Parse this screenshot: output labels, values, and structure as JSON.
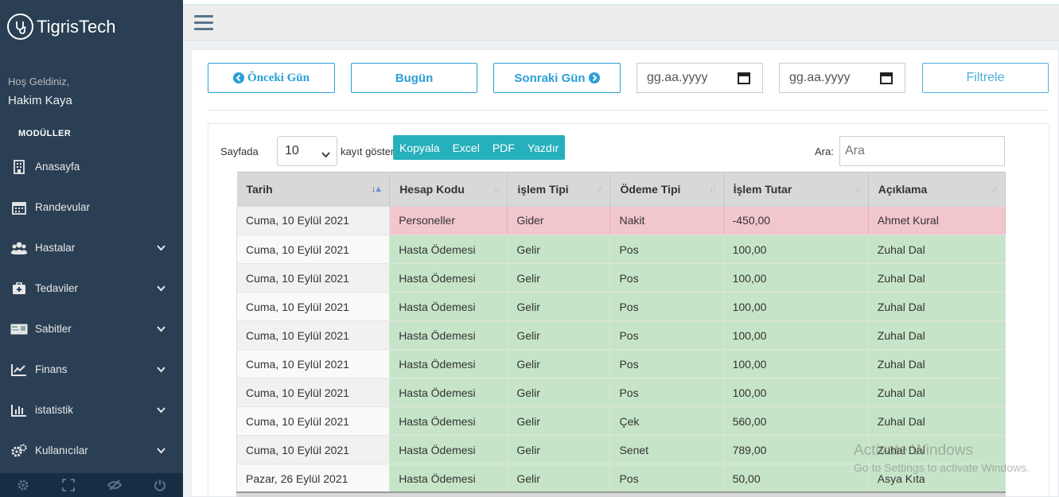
{
  "brand": {
    "name": "TigrisTech",
    "logo_icon": "stethoscope-icon"
  },
  "sidebar": {
    "welcome": "Hoş Geldiniz,",
    "username": "Hakim Kaya",
    "section_title": "MODÜLLER",
    "items": [
      {
        "label": "Anasayfa",
        "icon": "building-icon",
        "has_submenu": false
      },
      {
        "label": "Randevular",
        "icon": "calendar-icon",
        "has_submenu": false
      },
      {
        "label": "Hastalar",
        "icon": "users-icon",
        "has_submenu": true
      },
      {
        "label": "Tedaviler",
        "icon": "medkit-icon",
        "has_submenu": true
      },
      {
        "label": "Sabitler",
        "icon": "id-card-icon",
        "has_submenu": true
      },
      {
        "label": "Finans",
        "icon": "line-chart-icon",
        "has_submenu": true
      },
      {
        "label": "istatistik",
        "icon": "bar-chart-icon",
        "has_submenu": true
      },
      {
        "label": "Kullanıcılar",
        "icon": "cogs-icon",
        "has_submenu": true
      }
    ],
    "footer_icons": [
      "settings-icon",
      "fullscreen-icon",
      "eye-slash-icon",
      "power-icon"
    ]
  },
  "toolbar": {
    "prev_day": "Önceki Gün",
    "today": "Bugün",
    "next_day": "Sonraki Gün",
    "date_placeholder_start": "gg.aa.yyyy",
    "date_placeholder_end": "gg.aa.yyyy",
    "filter": "Filtrele"
  },
  "table_controls": {
    "length_prefix": "Sayfada",
    "length_value": "10",
    "length_suffix": "kayıt göster",
    "export_buttons": [
      "Kopyala",
      "Excel",
      "PDF",
      "Yazdır"
    ],
    "search_label": "Ara:",
    "search_placeholder": "Ara"
  },
  "table": {
    "columns": [
      "Tarih",
      "Hesap Kodu",
      "işlem Tipi",
      "Ödeme Tipi",
      "İşlem Tutar",
      "Açıklama"
    ],
    "rows": [
      {
        "date": "Cuma, 10 Eylül 2021",
        "account": "Personeller",
        "type": "Gider",
        "payment": "Nakit",
        "amount": "-450,00",
        "desc": "Ahmet Kural",
        "kind": "expense"
      },
      {
        "date": "Cuma, 10 Eylül 2021",
        "account": "Hasta Ödemesi",
        "type": "Gelir",
        "payment": "Pos",
        "amount": "100,00",
        "desc": "Zuhal Dal",
        "kind": "income"
      },
      {
        "date": "Cuma, 10 Eylül 2021",
        "account": "Hasta Ödemesi",
        "type": "Gelir",
        "payment": "Pos",
        "amount": "100,00",
        "desc": "Zuhal Dal",
        "kind": "income"
      },
      {
        "date": "Cuma, 10 Eylül 2021",
        "account": "Hasta Ödemesi",
        "type": "Gelir",
        "payment": "Pos",
        "amount": "100,00",
        "desc": "Zuhal Dal",
        "kind": "income"
      },
      {
        "date": "Cuma, 10 Eylül 2021",
        "account": "Hasta Ödemesi",
        "type": "Gelir",
        "payment": "Pos",
        "amount": "100,00",
        "desc": "Zuhal Dal",
        "kind": "income"
      },
      {
        "date": "Cuma, 10 Eylül 2021",
        "account": "Hasta Ödemesi",
        "type": "Gelir",
        "payment": "Pos",
        "amount": "100,00",
        "desc": "Zuhal Dal",
        "kind": "income"
      },
      {
        "date": "Cuma, 10 Eylül 2021",
        "account": "Hasta Ödemesi",
        "type": "Gelir",
        "payment": "Pos",
        "amount": "100,00",
        "desc": "Zuhal Dal",
        "kind": "income"
      },
      {
        "date": "Cuma, 10 Eylül 2021",
        "account": "Hasta Ödemesi",
        "type": "Gelir",
        "payment": "Çek",
        "amount": "560,00",
        "desc": "Zuhal Dal",
        "kind": "income"
      },
      {
        "date": "Cuma, 10 Eylül 2021",
        "account": "Hasta Ödemesi",
        "type": "Gelir",
        "payment": "Senet",
        "amount": "789,00",
        "desc": "Zuhal Dal",
        "kind": "income"
      },
      {
        "date": "Pazar, 26 Eylül 2021",
        "account": "Hasta Ödemesi",
        "type": "Gelir",
        "payment": "Pos",
        "amount": "50,00",
        "desc": "Asya Kıta",
        "kind": "income"
      }
    ]
  },
  "watermark": {
    "line1": "Activate Windows",
    "line2": "Go to Settings to activate Windows."
  },
  "colors": {
    "sidebar": "#2a3f54",
    "accent": "#2a9fd6",
    "expense_row": "#f2c6cd",
    "income_row": "#c6e5c8",
    "export_bg": "#26b0bc"
  }
}
